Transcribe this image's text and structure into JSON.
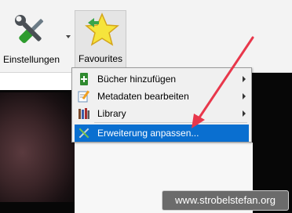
{
  "toolbar": {
    "settings_label": "Einstellungen",
    "favourites_label": "Favourites"
  },
  "menu": {
    "items": [
      {
        "label": "Bücher hinzufügen",
        "icon": "add-book-icon",
        "has_submenu": true
      },
      {
        "label": "Metadaten bearbeiten",
        "icon": "edit-metadata-icon",
        "has_submenu": true
      },
      {
        "label": "Library",
        "icon": "library-icon",
        "has_submenu": true
      },
      {
        "label": "Erweiterung anpassen...",
        "icon": "tweak-tools-icon",
        "has_submenu": false
      }
    ],
    "highlight_color": "#0a6fd0"
  },
  "watermark": "www.strobelstefan.org",
  "annotation_arrow_color": "#e8374b"
}
